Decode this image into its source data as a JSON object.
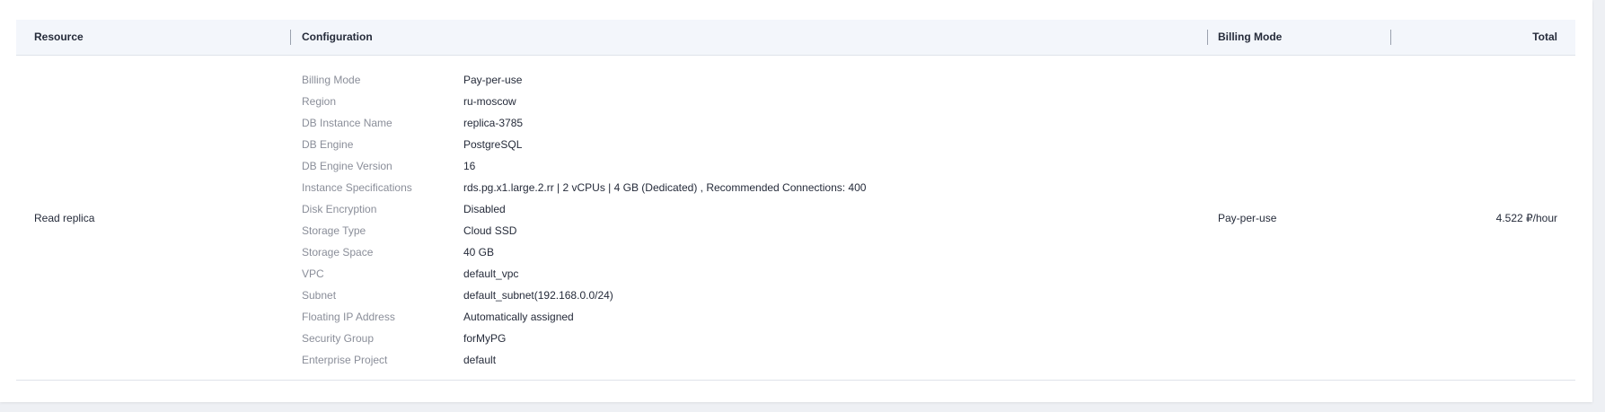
{
  "table": {
    "headers": {
      "resource": "Resource",
      "configuration": "Configuration",
      "billing_mode": "Billing Mode",
      "total": "Total"
    },
    "row": {
      "resource": "Read replica",
      "billing_mode": "Pay-per-use",
      "total": "4.522 ₽/hour",
      "configuration": [
        {
          "key": "Billing Mode",
          "value": "Pay-per-use"
        },
        {
          "key": "Region",
          "value": "ru-moscow"
        },
        {
          "key": "DB Instance Name",
          "value": "replica-3785"
        },
        {
          "key": "DB Engine",
          "value": "PostgreSQL"
        },
        {
          "key": "DB Engine Version",
          "value": "16"
        },
        {
          "key": "Instance Specifications",
          "value": "rds.pg.x1.large.2.rr | 2 vCPUs | 4 GB (Dedicated) , Recommended Connections: 400"
        },
        {
          "key": "Disk Encryption",
          "value": "Disabled"
        },
        {
          "key": "Storage Type",
          "value": "Cloud SSD"
        },
        {
          "key": "Storage Space",
          "value": "40 GB"
        },
        {
          "key": "VPC",
          "value": "default_vpc"
        },
        {
          "key": "Subnet",
          "value": "default_subnet(192.168.0.0/24)"
        },
        {
          "key": "Floating IP Address",
          "value": "Automatically assigned"
        },
        {
          "key": "Security Group",
          "value": "forMyPG"
        },
        {
          "key": "Enterprise Project",
          "value": "default"
        }
      ]
    }
  }
}
